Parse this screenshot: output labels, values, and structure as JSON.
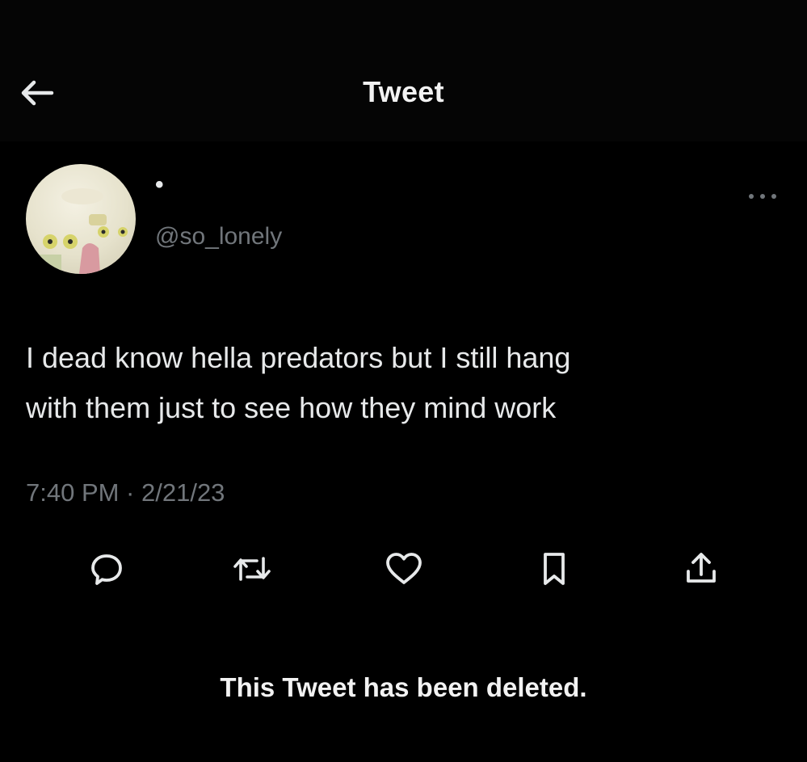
{
  "header": {
    "title": "Tweet",
    "back_icon": "arrow-left-icon"
  },
  "author": {
    "display_name": "•",
    "handle": "@so_lonely",
    "avatar_icon": "avatar"
  },
  "tweet": {
    "text": "I dead know hella predators but I still hang\nwith them just to see how they mind work",
    "timestamp": "7:40 PM · 2/21/23"
  },
  "actions": [
    {
      "name": "reply",
      "icon": "reply-icon"
    },
    {
      "name": "retweet",
      "icon": "retweet-icon"
    },
    {
      "name": "like",
      "icon": "heart-icon"
    },
    {
      "name": "bookmark",
      "icon": "bookmark-icon"
    },
    {
      "name": "share",
      "icon": "share-icon"
    }
  ],
  "notice": {
    "deleted": "This Tweet has been deleted."
  },
  "colors": {
    "background": "#000000",
    "primary_text": "#e7e9ea",
    "secondary_text": "#71767b"
  }
}
